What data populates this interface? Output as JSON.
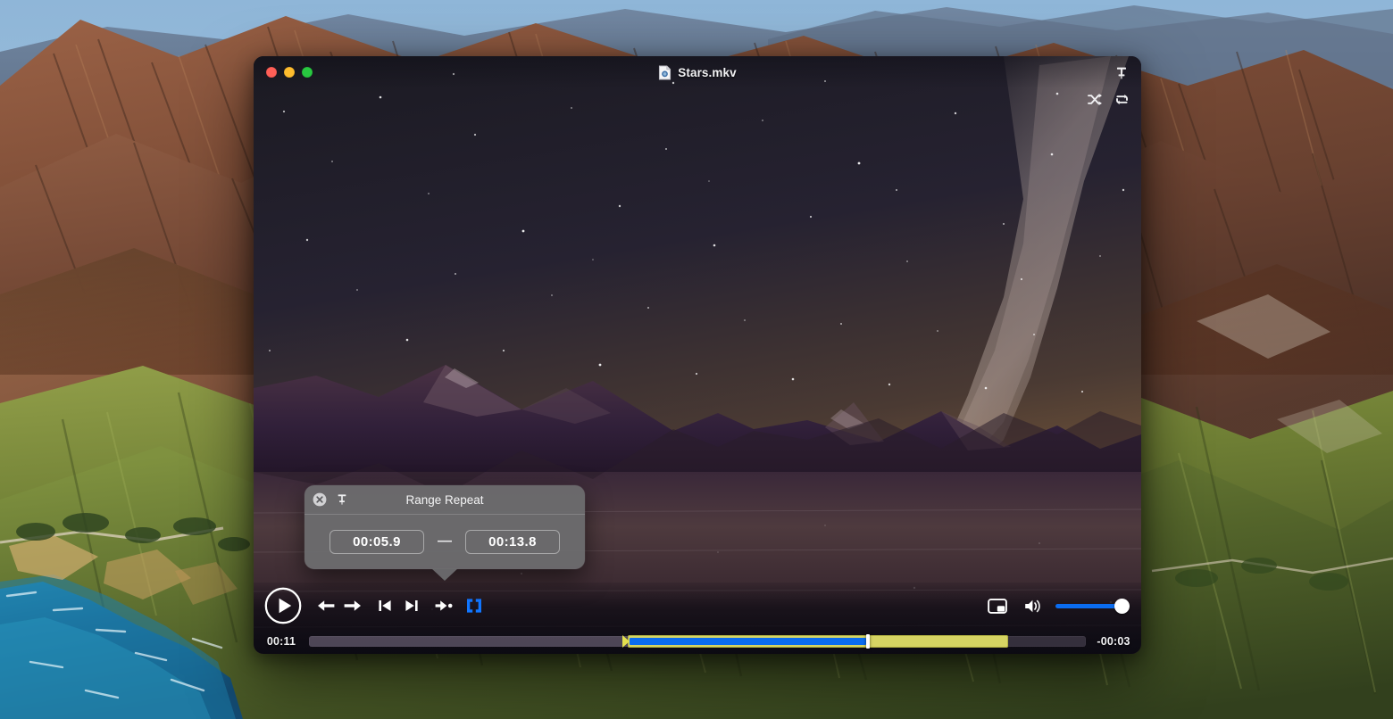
{
  "desktop": {
    "wallpaper_name": "big-sur-coastline",
    "sky_color": "#7fa8d0",
    "ocean_color": "#1f6f9e",
    "hill_warm": "#8a5a3c",
    "hill_green": "#6d7a33"
  },
  "window": {
    "title": "Stars.mkv",
    "file_icon": "document-icon",
    "traffic_lights": [
      {
        "name": "close",
        "color": "#ff5f57"
      },
      {
        "name": "minimize",
        "color": "#febc2e"
      },
      {
        "name": "maximize",
        "color": "#28c840"
      }
    ],
    "pin_icon": "pin-icon"
  },
  "mode_controls": [
    {
      "name": "shuffle-icon",
      "label": "Shuffle",
      "active": false
    },
    {
      "name": "repeat-icon",
      "label": "Repeat",
      "active": false
    }
  ],
  "transport": {
    "play_label": "Play",
    "play_icon": "play-icon",
    "buttons": [
      {
        "name": "step-backward-icon",
        "label": "Skip Backward"
      },
      {
        "name": "step-forward-icon",
        "label": "Skip Forward"
      },
      {
        "name": "previous-chapter-icon",
        "label": "Previous"
      },
      {
        "name": "next-chapter-icon",
        "label": "Next"
      },
      {
        "name": "speed-icon",
        "label": "Playback Speed"
      },
      {
        "name": "range-repeat-icon",
        "label": "Range Repeat",
        "active": true
      }
    ],
    "accent_color": "#0a6cf0"
  },
  "right_controls": {
    "pip_icon": "picture-in-picture-icon",
    "pip_label": "Picture in Picture",
    "volume_icon": "speaker-icon",
    "volume_label": "Volume",
    "volume_value": 100,
    "volume_color": "#0a6cf0"
  },
  "seek": {
    "elapsed": "00:11",
    "remaining": "-00:03",
    "progress_percent": 41,
    "loop_start_percent": 41,
    "loop_end_percent": 90,
    "playhead_percent": 72,
    "loop_band_color": "#d6d463",
    "progress_color": "#0a6cf0",
    "playhead_color": "#ffffff"
  },
  "range_repeat_popover": {
    "title": "Range Repeat",
    "close_icon": "close-icon",
    "pin_icon": "pin-icon",
    "start_time": "00:05.9",
    "separator": "—",
    "end_time": "00:13.8"
  }
}
